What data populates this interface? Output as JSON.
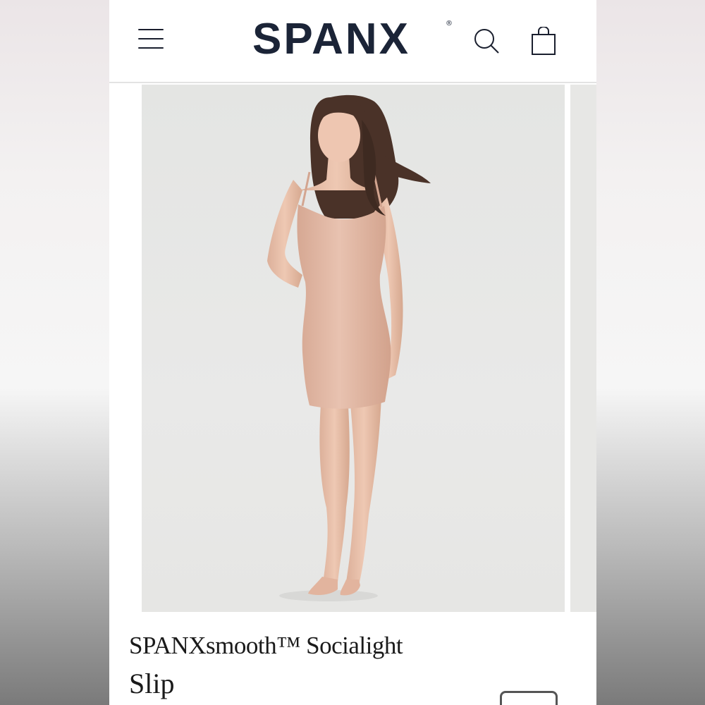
{
  "header": {
    "logo": "SPANX",
    "logo_mark": "®",
    "icons": {
      "menu": "hamburger-menu-icon",
      "search": "search-icon",
      "bag": "shopping-bag-icon"
    }
  },
  "gallery": {
    "main_image": "model-wearing-nude-slip"
  },
  "product": {
    "title_line1": "SPANXsmooth™ Socialight",
    "title_line2": "Slip"
  },
  "colors": {
    "brand_navy": "#1b2437",
    "slip": "#e2b9a6",
    "skin": "#e8bfa8",
    "hair": "#4a3228"
  }
}
